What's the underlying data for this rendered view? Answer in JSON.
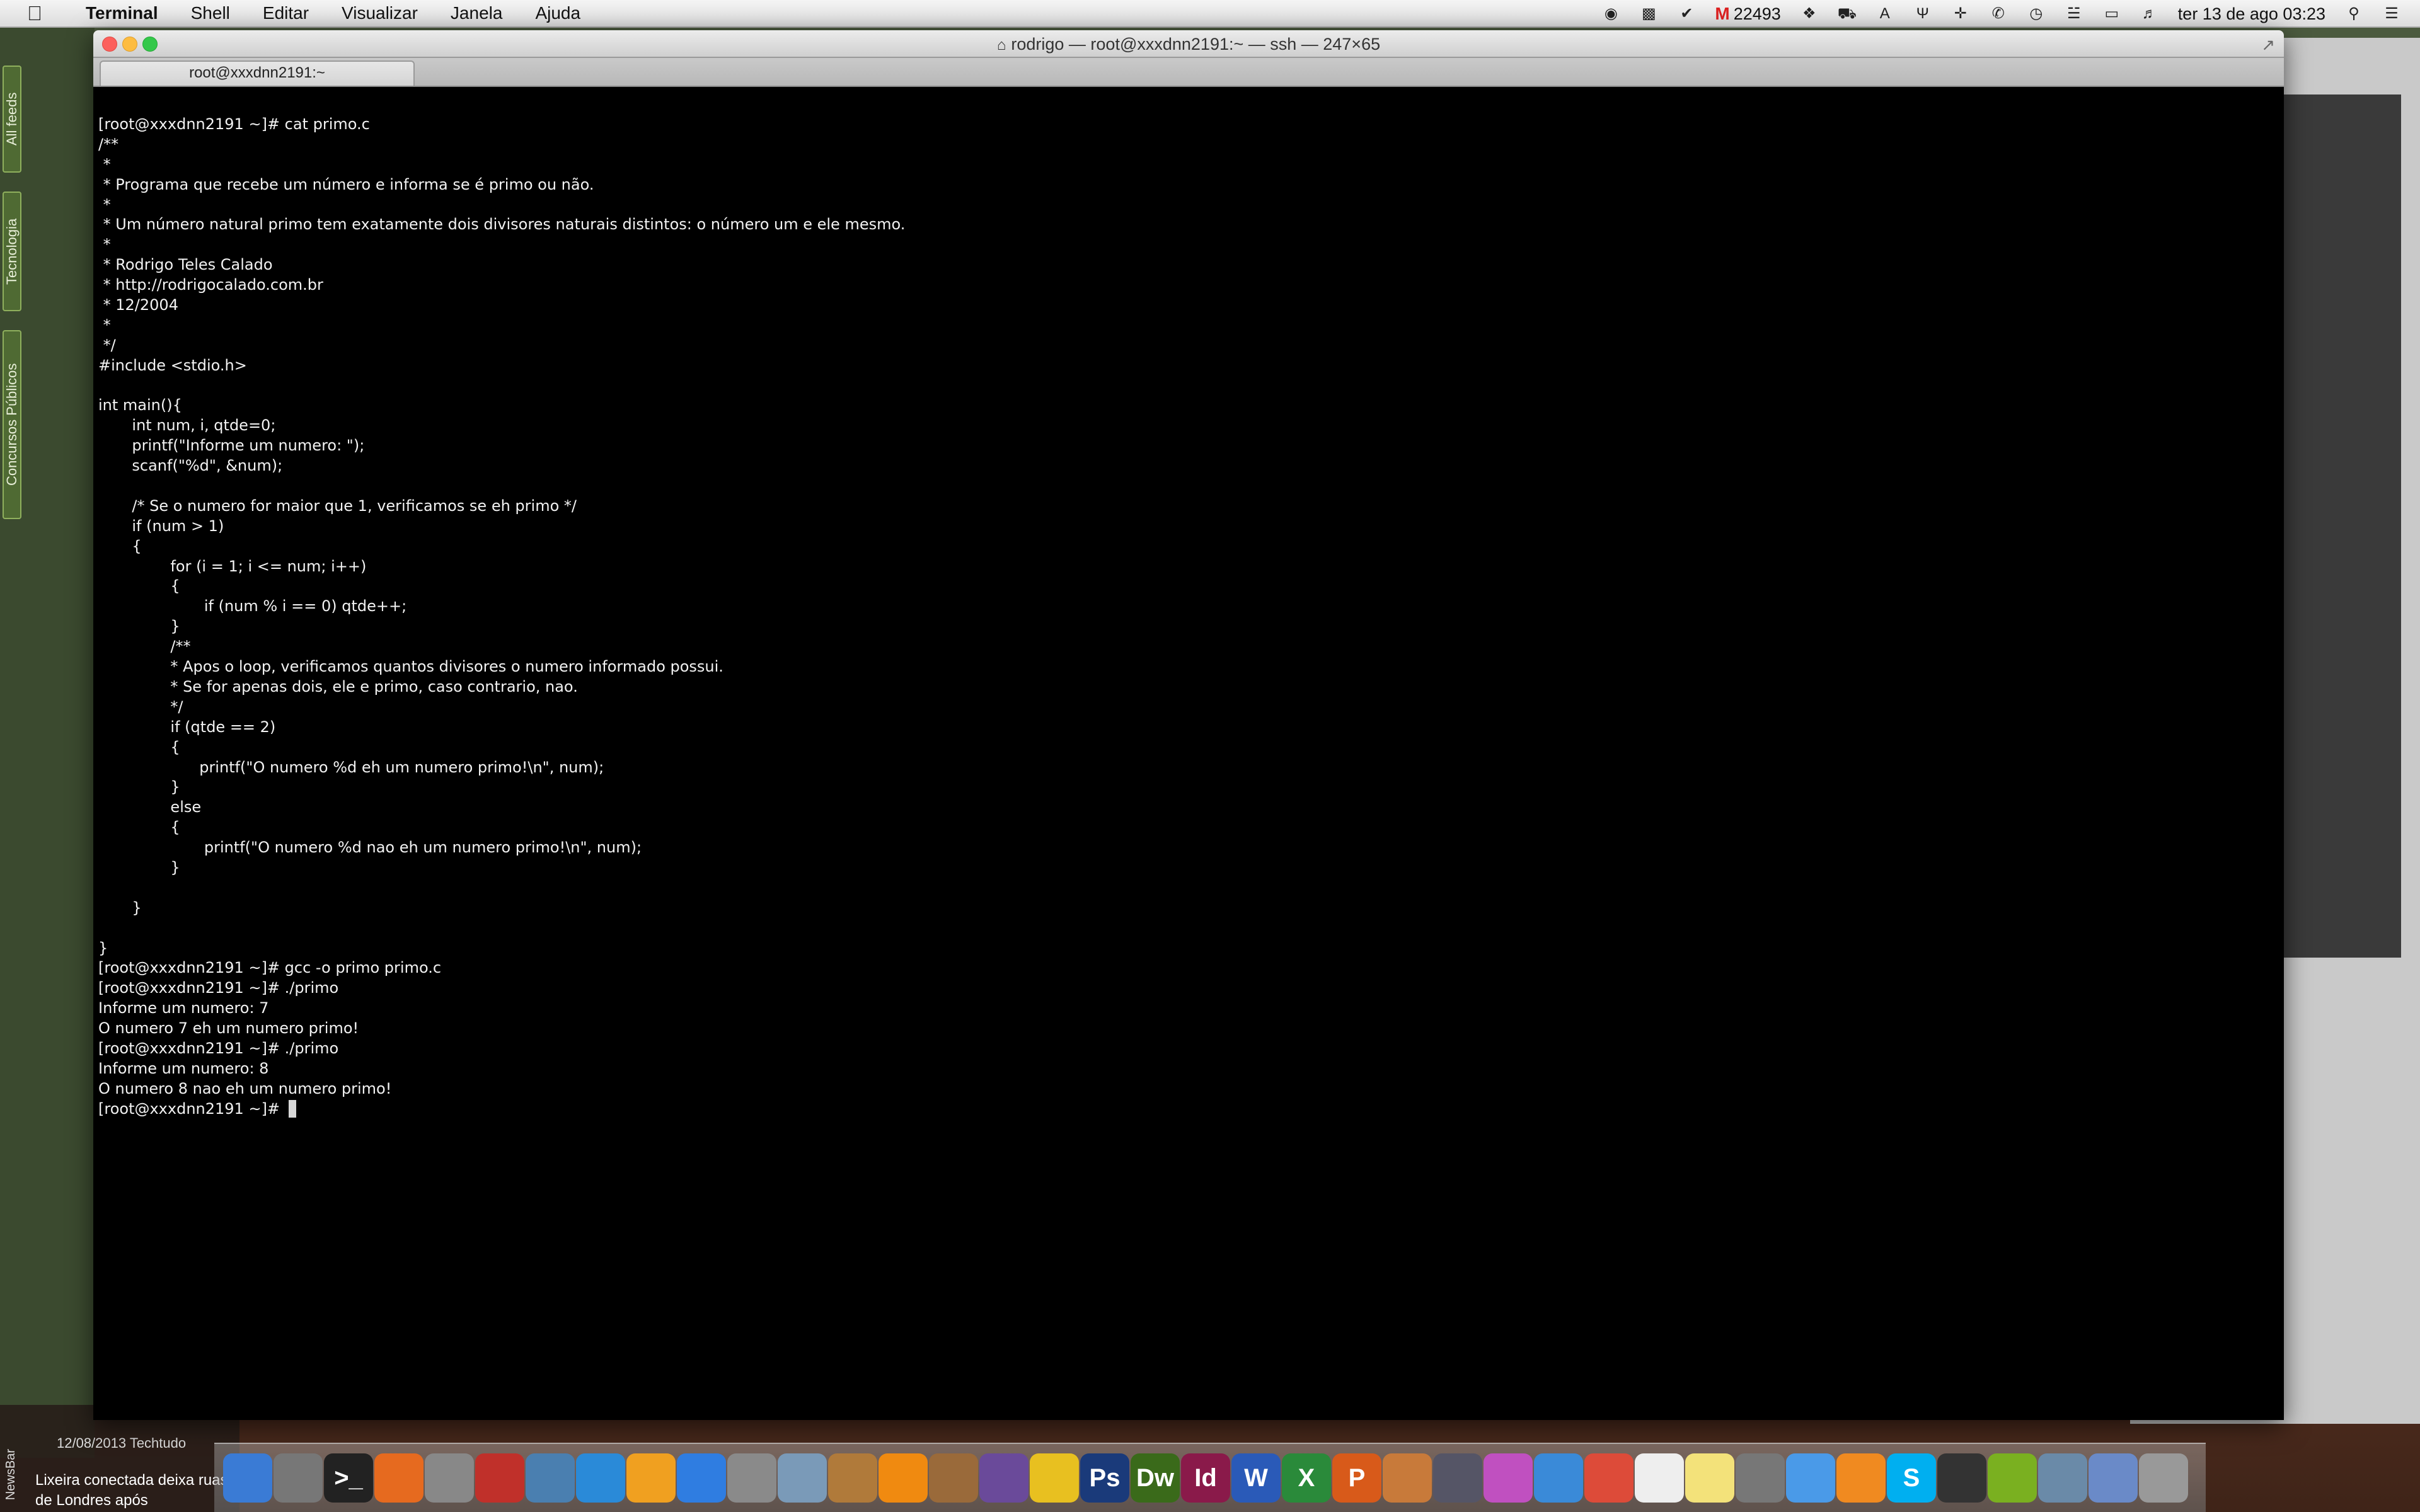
{
  "menubar": {
    "app_name": "Terminal",
    "menus": [
      "Shell",
      "Editar",
      "Visualizar",
      "Janela",
      "Ajuda"
    ],
    "mail_count": "22493",
    "datetime": "ter 13 de ago  03:23"
  },
  "window": {
    "title": "rodrigo — root@xxxdnn2191:~ — ssh — 247×65",
    "tab_label": "root@xxxdnn2191:~"
  },
  "feed_reader": {
    "tabs": [
      "All feeds",
      "Tecnologia",
      "Concursos Públicos"
    ],
    "newsbar_label": "NewsBar",
    "news_date": "12/08/2013 Techtudo",
    "news_headline": "Lixeira conectada deixa ruas de Londres após"
  },
  "terminal": {
    "lines": [
      "[root@xxxdnn2191 ~]# cat primo.c",
      "/**",
      " *",
      " * Programa que recebe um número e informa se é primo ou não.",
      " *",
      " * Um número natural primo tem exatamente dois divisores naturais distintos: o número um e ele mesmo.",
      " *",
      " * Rodrigo Teles Calado",
      " * http://rodrigocalado.com.br",
      " * 12/2004",
      " *",
      " */",
      "#include <stdio.h>",
      "",
      "int main(){",
      "       int num, i, qtde=0;",
      "       printf(\"Informe um numero: \");",
      "       scanf(\"%d\", &num);",
      "",
      "       /* Se o numero for maior que 1, verificamos se eh primo */",
      "       if (num > 1)",
      "       {",
      "               for (i = 1; i <= num; i++)",
      "               {",
      "                      if (num % i == 0) qtde++;",
      "               }",
      "               /**",
      "               * Apos o loop, verificamos quantos divisores o numero informado possui.",
      "               * Se for apenas dois, ele e primo, caso contrario, nao.",
      "               */",
      "               if (qtde == 2)",
      "               {",
      "                     printf(\"O numero %d eh um numero primo!\\n\", num);",
      "               }",
      "               else",
      "               {",
      "                      printf(\"O numero %d nao eh um numero primo!\\n\", num);",
      "               }",
      "",
      "       }",
      "",
      "}",
      "[root@xxxdnn2191 ~]# gcc -o primo primo.c",
      "[root@xxxdnn2191 ~]# ./primo",
      "Informe um numero: 7",
      "O numero 7 eh um numero primo!",
      "[root@xxxdnn2191 ~]# ./primo",
      "Informe um numero: 8",
      "O numero 8 nao eh um numero primo!",
      "[root@xxxdnn2191 ~]# "
    ]
  },
  "dock": {
    "icons": [
      "finder",
      "system-settings",
      "terminal",
      "firefox",
      "automator",
      "acrobat",
      "workbench",
      "itunes",
      "settings",
      "app-store",
      "preferences",
      "mail",
      "nuts",
      "vlc",
      "transmit",
      "magnifier",
      "flash",
      "photoshop",
      "dreamweaver",
      "indesign",
      "word",
      "excel",
      "powerpoint",
      "presentation",
      "sketch",
      "flower",
      "safari",
      "chrome",
      "document",
      "notes",
      "photos",
      "messages",
      "rss",
      "skype",
      "console",
      "android",
      "network",
      "folder",
      "trash"
    ]
  }
}
